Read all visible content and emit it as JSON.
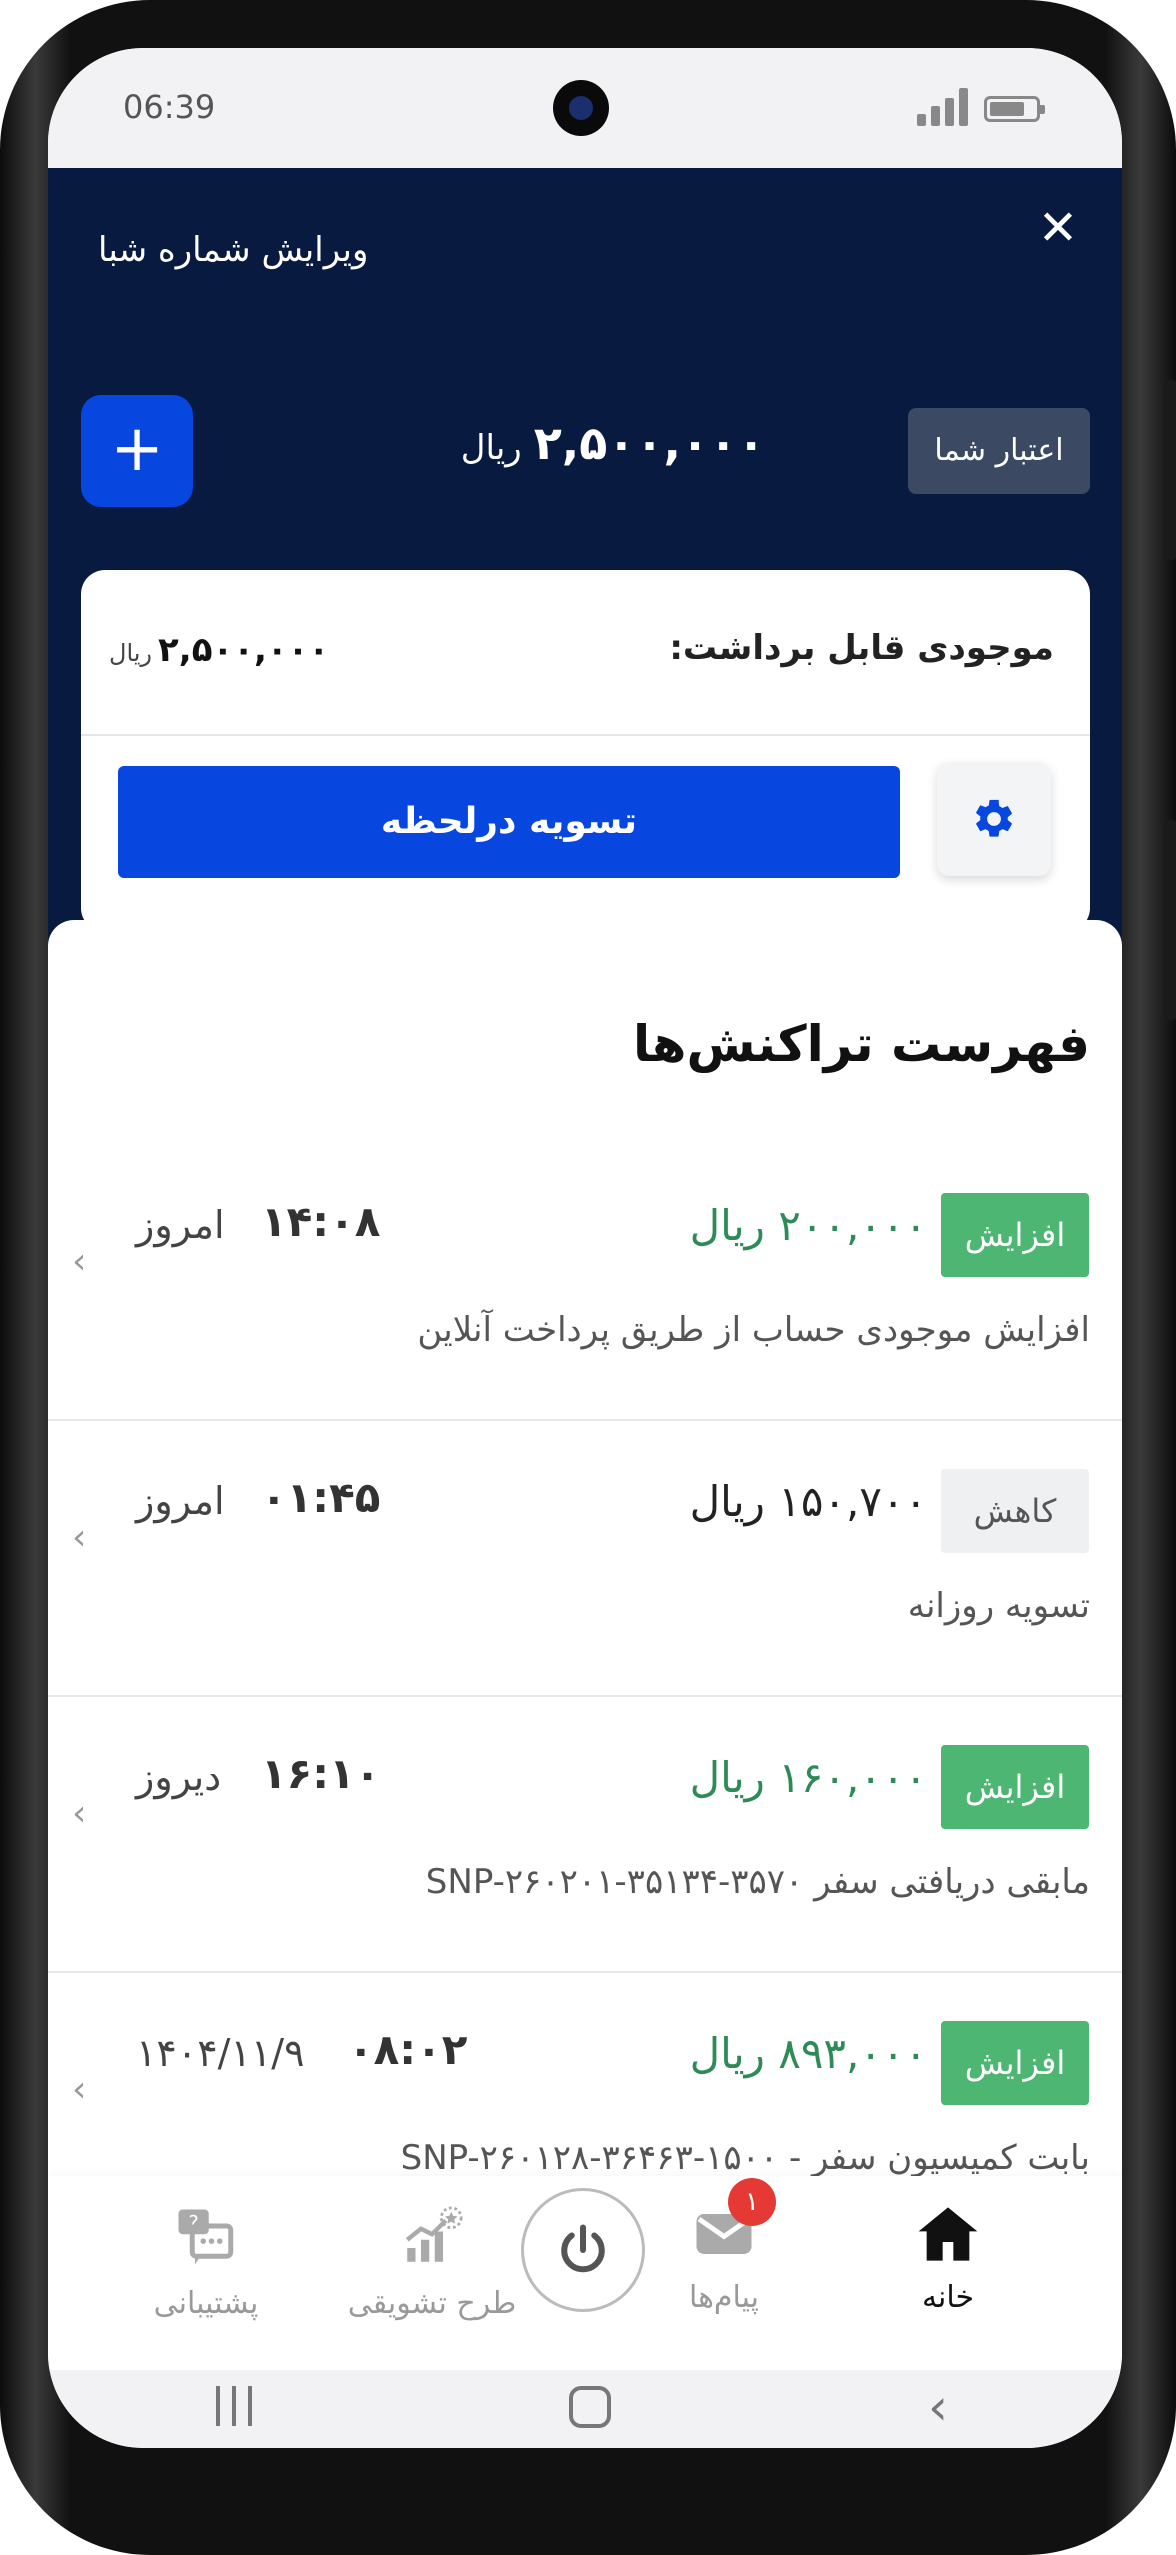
{
  "status_bar": {
    "time": "06:39"
  },
  "header": {
    "edit_sheba": "ویرایش شماره شبا",
    "credit_label": "اعتبار شما",
    "credit_amount": "۲,۵۰۰,۰۰۰",
    "credit_currency": "ریال"
  },
  "balance": {
    "label": "موجودی قابل برداشت:",
    "amount": "۲,۵۰۰,۰۰۰",
    "currency": "ریال",
    "settle_button": "تسویه درلحظه"
  },
  "transactions": {
    "title": "فهرست تراکنش‌ها",
    "items": [
      {
        "type": "افزایش",
        "kind": "up",
        "amount": "۲۰۰,۰۰۰ ریال",
        "time": "۱۴:۰۸",
        "date": "امروز",
        "description": "افزایش موجودی حساب از طریق پرداخت آنلاین"
      },
      {
        "type": "کاهش",
        "kind": "down",
        "amount": "۱۵۰,۷۰۰ ریال",
        "time": "۰۱:۴۵",
        "date": "امروز",
        "description": "تسویه روزانه"
      },
      {
        "type": "افزایش",
        "kind": "up",
        "amount": "۱۶۰,۰۰۰ ریال",
        "time": "۱۶:۱۰",
        "date": "دیروز",
        "description": "مابقی دریافتی سفر SNP-۲۶۰۲۰۱-۳۵۱۳۴-۳۵۷۰"
      },
      {
        "type": "افزایش",
        "kind": "up",
        "amount": "۸۹۳,۰۰۰ ریال",
        "time": "۰۸:۰۲",
        "date": "۱۴۰۴/۱۱/۹",
        "description": "بابت کمیسیون سفر - SNP-۲۶۰۱۲۸-۳۶۴۶۳-۱۵۰۰"
      }
    ]
  },
  "bottom_nav": {
    "home": "خانه",
    "messages": "پیام‌ها",
    "messages_badge": "۱",
    "incentive": "طرح تشویقی",
    "support": "پشتیبانی"
  },
  "colors": {
    "header_bg": "#091a41",
    "primary": "#0747e0",
    "increase": "#4cb672",
    "decrease_badge": "#eef0f2",
    "notification": "#e53935"
  },
  "icons": [
    "close-icon",
    "plus-icon",
    "gear-icon",
    "chevron-left-icon",
    "home-icon",
    "mail-icon",
    "power-icon",
    "chart-star-icon",
    "support-chat-icon"
  ]
}
